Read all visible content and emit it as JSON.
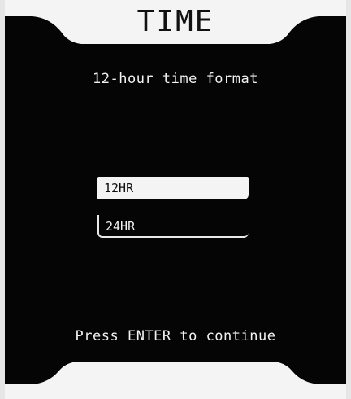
{
  "header": {
    "title": "TIME"
  },
  "setting": {
    "description": "12-hour time format"
  },
  "options": [
    {
      "label": "12HR",
      "selected": true
    },
    {
      "label": "24HR",
      "selected": false
    }
  ],
  "footer": {
    "prompt": "Press ENTER to continue"
  },
  "colors": {
    "screen_background": "#050505",
    "bezel": "#f4f4f4",
    "text": "#f2f2f2",
    "highlight": "#f4f4f4"
  }
}
